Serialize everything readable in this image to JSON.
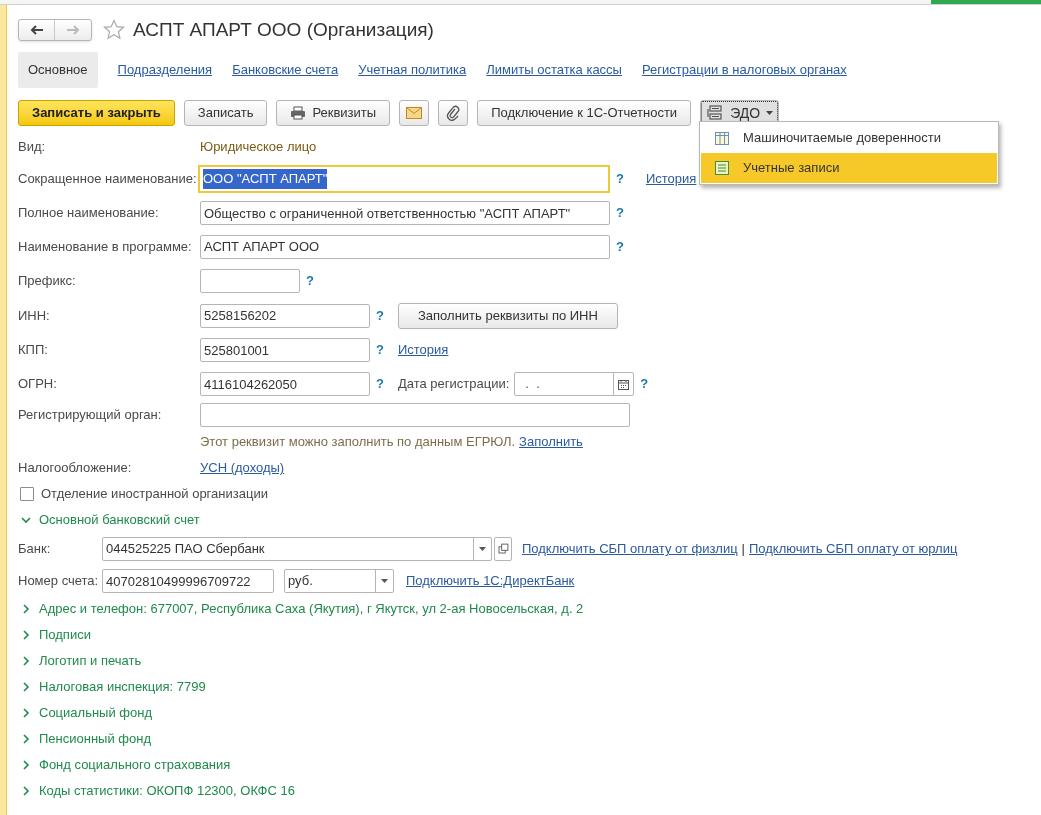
{
  "header": {
    "title": "АСПТ АПАРТ ООО (Организация)",
    "favorite": false,
    "back_enabled": true,
    "forward_enabled": false
  },
  "nav_tabs": [
    {
      "label": "Основное",
      "selected": true
    },
    {
      "label": "Подразделения",
      "selected": false
    },
    {
      "label": "Банковские счета",
      "selected": false
    },
    {
      "label": "Учетная политика",
      "selected": false
    },
    {
      "label": "Лимиты остатка кассы",
      "selected": false
    },
    {
      "label": "Регистрации в налоговых органах",
      "selected": false
    }
  ],
  "toolbar": [
    {
      "kind": "primary",
      "label": "Записать и закрыть"
    },
    {
      "kind": "text",
      "label": "Записать"
    },
    {
      "kind": "print",
      "label": "Реквизиты"
    },
    {
      "kind": "mail"
    },
    {
      "kind": "clip"
    },
    {
      "kind": "text",
      "label": "Подключение к 1С-Отчетности"
    },
    {
      "kind": "menu",
      "label": "ЭДО",
      "expanded": true
    }
  ],
  "edo_menu": [
    {
      "kind": "table",
      "label": "Машиночитаемые доверенности",
      "selected": false
    },
    {
      "kind": "list",
      "label": "Учетные записи",
      "selected": true
    }
  ],
  "form": [
    {
      "kind": "static",
      "label": "Вид:",
      "value": "Юридическое лицо"
    },
    {
      "kind": "input",
      "label": "Сокращенное наименование:",
      "value": "ООО \"АСПТ АПАРТ\"",
      "focused": true,
      "help": "?",
      "link": "История"
    },
    {
      "kind": "input",
      "label": "Полное наименование:",
      "value": "Общество с ограниченной ответственностью \"АСПТ АПАРТ\"",
      "focused": false,
      "help": "?"
    },
    {
      "kind": "input",
      "label": "Наименование в программе:",
      "value": "АСПТ АПАРТ ООО",
      "focused": false,
      "help": "?"
    },
    {
      "kind": "input",
      "label": "Префикс:",
      "focused": false,
      "help": "?"
    },
    {
      "kind": "input",
      "label": "ИНН:",
      "value": "5258156202",
      "focused": false,
      "help": "?",
      "button": "Заполнить реквизиты по ИНН"
    },
    {
      "kind": "input",
      "label": "КПП:",
      "value": "525801001",
      "focused": false,
      "help": "?",
      "link": "История"
    },
    {
      "kind": "input",
      "label": "ОГРН:",
      "value": "4116104262050",
      "focused": false,
      "help": "?",
      "date_label": "Дата регистрации:",
      "date_value": ".  .",
      "date_help": "?"
    },
    {
      "kind": "input",
      "label": "Регистрирующий орган:",
      "focused": false
    },
    {
      "kind": "hint",
      "text": "Этот реквизит можно заполнить по данным ЕГРЮЛ.",
      "link": "Заполнить"
    },
    {
      "kind": "link",
      "label": "Налогообложение:",
      "value": "УСН (доходы)"
    },
    {
      "kind": "checkbox",
      "label": "Отделение иностранной организации",
      "checked": false
    }
  ],
  "bank_section": {
    "title": "Основной банковский счет",
    "expanded": true,
    "bank": {
      "label": "Банк:",
      "value": "044525225 ПАО Сбербанк",
      "links": [
        "Подключить СБП оплату от физлиц",
        "Подключить СБП оплату от юрлиц"
      ],
      "separator": "|"
    },
    "account": {
      "label": "Номер счета:",
      "value": "40702810499996709722",
      "currency": "руб.",
      "link": "Подключить 1С:ДиректБанк"
    }
  },
  "sections": [
    {
      "title": "Адрес и телефон: 677007, Республика Саха (Якутия), г Якутск, ул 2-ая Новосельская, д. 2",
      "expanded": false
    },
    {
      "title": "Подписи",
      "expanded": false
    },
    {
      "title": "Логотип и печать",
      "expanded": false
    },
    {
      "title": "Налоговая инспекция: 7799",
      "expanded": false
    },
    {
      "title": "Социальный фонд",
      "expanded": false
    },
    {
      "title": "Пенсионный фонд",
      "expanded": false
    },
    {
      "title": "Фонд социального страхования",
      "expanded": false
    },
    {
      "title": "Коды статистики: ОКОПФ 12300, ОКФС 16",
      "expanded": false
    }
  ]
}
